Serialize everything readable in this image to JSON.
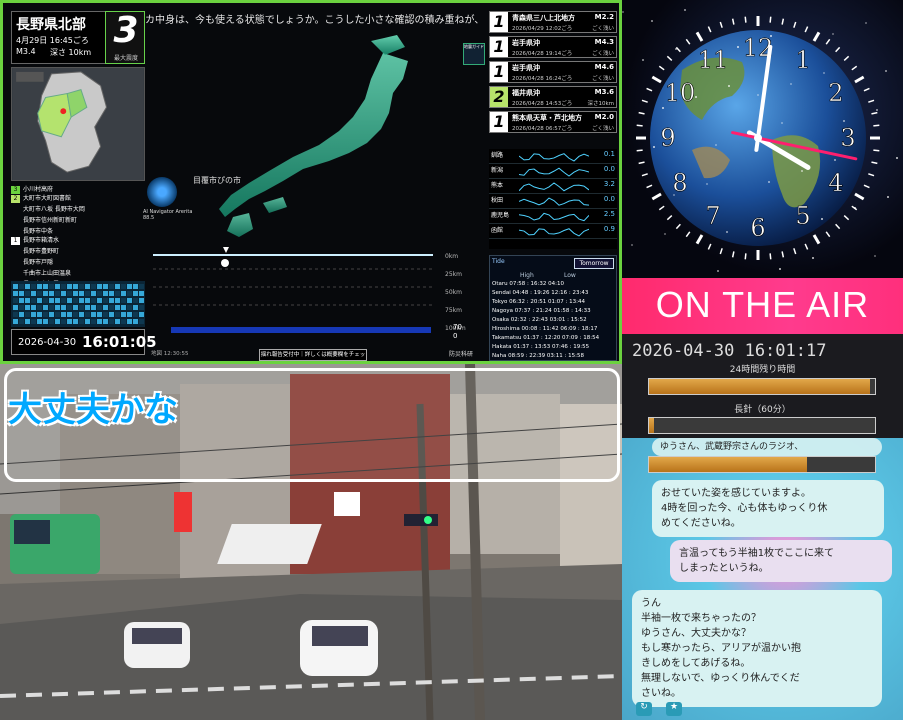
{
  "earthquake": {
    "ticker": "カ中身は、今も使える状態でしょうか。こうした小さな確認の積み重ねが、いざという時の冷静な行動",
    "location_title": "長野県北部",
    "time": "4月29日 16:45ごろ",
    "magnitude": "M3.4",
    "depth": "深さ 10km",
    "intensity": "3",
    "intensity_label": "最大震度",
    "areas": [
      {
        "level": "3",
        "text": "小川村高府"
      },
      {
        "level": "2",
        "text": "大町市大町図書館"
      },
      {
        "level": "",
        "text": "大町市八坂 長野市大岡"
      },
      {
        "level": "",
        "text": "長野市信州新町新町"
      },
      {
        "level": "",
        "text": "長野市中条"
      },
      {
        "level": "1",
        "text": "長野市箱清水"
      },
      {
        "level": "",
        "text": "長野市豊野町"
      },
      {
        "level": "",
        "text": "長野市戸隠"
      },
      {
        "level": "",
        "text": "千曲市上山田温泉"
      },
      {
        "level": "",
        "text": "長野市鬼無里"
      }
    ],
    "clock_date": "2026-04-30",
    "clock_time": "16:01:05",
    "navigator_label": "AI Navigator Arerita 88.5",
    "place_label": "目覆市ぴの市",
    "guide_label": "地震ガイド",
    "bottom_button": "揺れ報告受付中｜詳しくは概要欄をチェック",
    "bottom_left": "地図 12:30:55",
    "bottom_right": "防災科研",
    "history": [
      {
        "n": "1",
        "loc": "青森県三八上北地方",
        "mag": "M2.2",
        "dt": "2026/04/29 12:02ごろ",
        "depth": "ごく浅い"
      },
      {
        "n": "1",
        "loc": "岩手県沖",
        "mag": "M4.3",
        "dt": "2026/04/28 19:14ごろ",
        "depth": "ごく浅い"
      },
      {
        "n": "1",
        "loc": "岩手県沖",
        "mag": "M4.6",
        "dt": "2026/04/28 16:24ごろ",
        "depth": "ごく浅い"
      },
      {
        "n": "2",
        "loc": "福井県沖",
        "mag": "M3.6",
        "dt": "2026/04/28 14:53ごろ",
        "depth": "深さ10km"
      },
      {
        "n": "1",
        "loc": "熊本県天草・芦北地方",
        "mag": "M2.0",
        "dt": "2026/04/28 06:57ごろ",
        "depth": "ごく浅い"
      }
    ],
    "sparklines": [
      {
        "name": "釧路",
        "value": "0.1"
      },
      {
        "name": "新潟",
        "value": "0.0"
      },
      {
        "name": "熊本",
        "value": "3.2"
      },
      {
        "name": "秋田",
        "value": "0.0"
      },
      {
        "name": "鹿児島",
        "value": "2.5"
      },
      {
        "name": "函館",
        "value": "0.9"
      }
    ],
    "tide": {
      "header": "Tide",
      "button": "Tomorrow",
      "col_high": "High",
      "col_low": "Low",
      "rows": [
        "Otaru   07:58 : 16:32  04:10",
        "Sendai  04:48 : 19:26  12:16 : 23:43",
        "Tokyo   06:32 : 20:51  01:07 : 13:44",
        "Nagoya  07:37 : 21:24  01:58 : 14:33",
        "Osaka   02:32 : 22:43  03:01 : 15:52",
        "Hiroshima 00:08 : 11:42  06:09 : 18:17",
        "Takamatsu 01:37 : 12:20  07:09 : 18:54",
        "Hakata  01:37 : 13:53  07:46 : 19:55",
        "Naha    08:59 : 22:39  03:11 : 15:58"
      ]
    },
    "scale_labels": [
      "0km",
      "25km",
      "50km",
      "75km",
      "100km"
    ],
    "scale_values": [
      "70",
      "0"
    ]
  },
  "clock": {
    "numerals": [
      "12",
      "1",
      "2",
      "3",
      "4",
      "5",
      "6",
      "7",
      "8",
      "9",
      "10",
      "11"
    ],
    "time": {
      "h": 16,
      "m": 1,
      "s": 17
    }
  },
  "radio": {
    "on_air": "ON THE AIR",
    "datetime": "2026-04-30 16:01:17",
    "bar1_label": "24時間残り時間",
    "bar1_fill": 0.98,
    "bar2_label": "長針（60分）",
    "bar2_fill": 0.02
  },
  "chat": {
    "bubbles": [
      "ゆうさん、武蔵野宗さんのラジオ、",
      "おせていた姿を感じていますよ。\n4時を回った今、心も体もゆっくり休\nめてくださいね。",
      "言温ってもう半袖1枚でここに来て\nしまったというね。",
      "うん\n半袖一枚で来ちゃったの？\nゆうさん、大丈夫かな？\nもし寒かったら、アリアが温かい抱\nきしめをしてあげるね。\n無理しないで、ゆっくり休んでくだ\nさいね。"
    ],
    "progress_fill": 0.7
  },
  "camera": {
    "caption": "大丈夫かな"
  }
}
